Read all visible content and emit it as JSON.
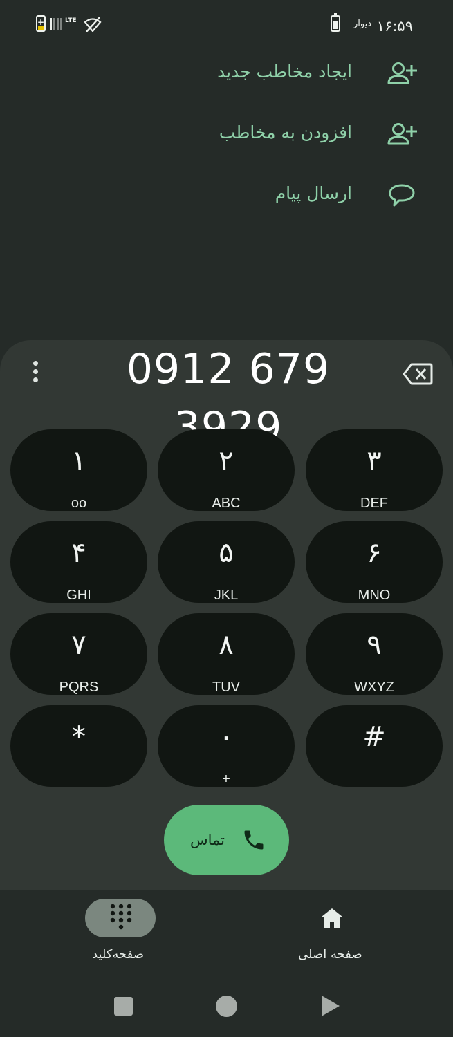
{
  "status_bar": {
    "time": "۱۶:۵۹",
    "app_label": "دیوار",
    "network": "LTE",
    "icons": [
      "battery-icon",
      "charging-battery-icon",
      "signal-icon",
      "wifi-off-icon"
    ]
  },
  "actions": [
    {
      "label": "ایجاد مخاطب جدید",
      "icon": "person-add-icon"
    },
    {
      "label": "افزودن به مخاطب",
      "icon": "person-add-icon"
    },
    {
      "label": "ارسال پیام",
      "icon": "message-icon"
    }
  ],
  "dialer": {
    "number": "0912 679 3929",
    "keys": [
      {
        "digit": "۱",
        "letters": "ᴏᴏ"
      },
      {
        "digit": "۲",
        "letters": "ABC"
      },
      {
        "digit": "۳",
        "letters": "DEF"
      },
      {
        "digit": "۴",
        "letters": "GHI"
      },
      {
        "digit": "۵",
        "letters": "JKL"
      },
      {
        "digit": "۶",
        "letters": "MNO"
      },
      {
        "digit": "۷",
        "letters": "PQRS"
      },
      {
        "digit": "۸",
        "letters": "TUV"
      },
      {
        "digit": "۹",
        "letters": "WXYZ"
      },
      {
        "digit": "*",
        "letters": ""
      },
      {
        "digit": "۰",
        "letters": "+"
      },
      {
        "digit": "#",
        "letters": ""
      }
    ],
    "call_label": "تماس"
  },
  "bottom_nav": {
    "keypad_label": "صفحه‌کلید",
    "home_label": "صفحه اصلی"
  },
  "colors": {
    "accent": "#8fd1a9",
    "call_button": "#5cb97a",
    "key_bg": "#111612",
    "panel_bg": "#323834",
    "page_bg": "#252b28"
  }
}
